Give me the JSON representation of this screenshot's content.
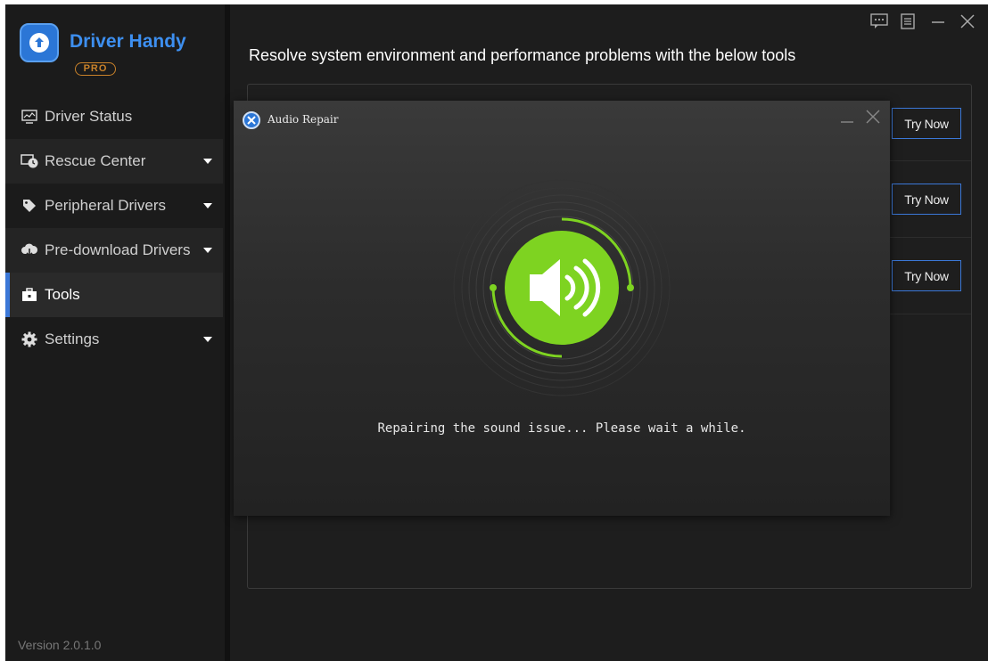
{
  "app": {
    "name": "Driver Handy",
    "edition": "PRO",
    "version": "Version 2.0.1.0"
  },
  "window_controls": [
    "feedback-icon",
    "menu-icon",
    "minimize-icon",
    "close-icon"
  ],
  "sidebar": {
    "items": [
      {
        "label": "Driver Status",
        "icon": "monitor-icon",
        "has_caret": false
      },
      {
        "label": "Rescue Center",
        "icon": "clock-backup-icon",
        "has_caret": true
      },
      {
        "label": "Peripheral Drivers",
        "icon": "tag-icon",
        "has_caret": true
      },
      {
        "label": "Pre-download Drivers",
        "icon": "cloud-download-icon",
        "has_caret": true
      },
      {
        "label": "Tools",
        "icon": "toolbox-icon",
        "has_caret": false,
        "active": true
      },
      {
        "label": "Settings",
        "icon": "gear-icon",
        "has_caret": true
      }
    ]
  },
  "main": {
    "title": "Resolve system environment and performance problems with the below tools",
    "tools": [
      {
        "button": "Try Now"
      },
      {
        "button": "Try Now"
      },
      {
        "button": "Try Now"
      }
    ]
  },
  "dialog": {
    "title": "Audio Repair",
    "status": "Repairing the sound issue... Please wait a while.",
    "icon": "speaker-icon",
    "accent_color": "#7ed321"
  },
  "colors": {
    "brand": "#3d8ff0",
    "pro": "#c9822a",
    "active_indicator": "#3b78d8",
    "success": "#7ed321"
  }
}
